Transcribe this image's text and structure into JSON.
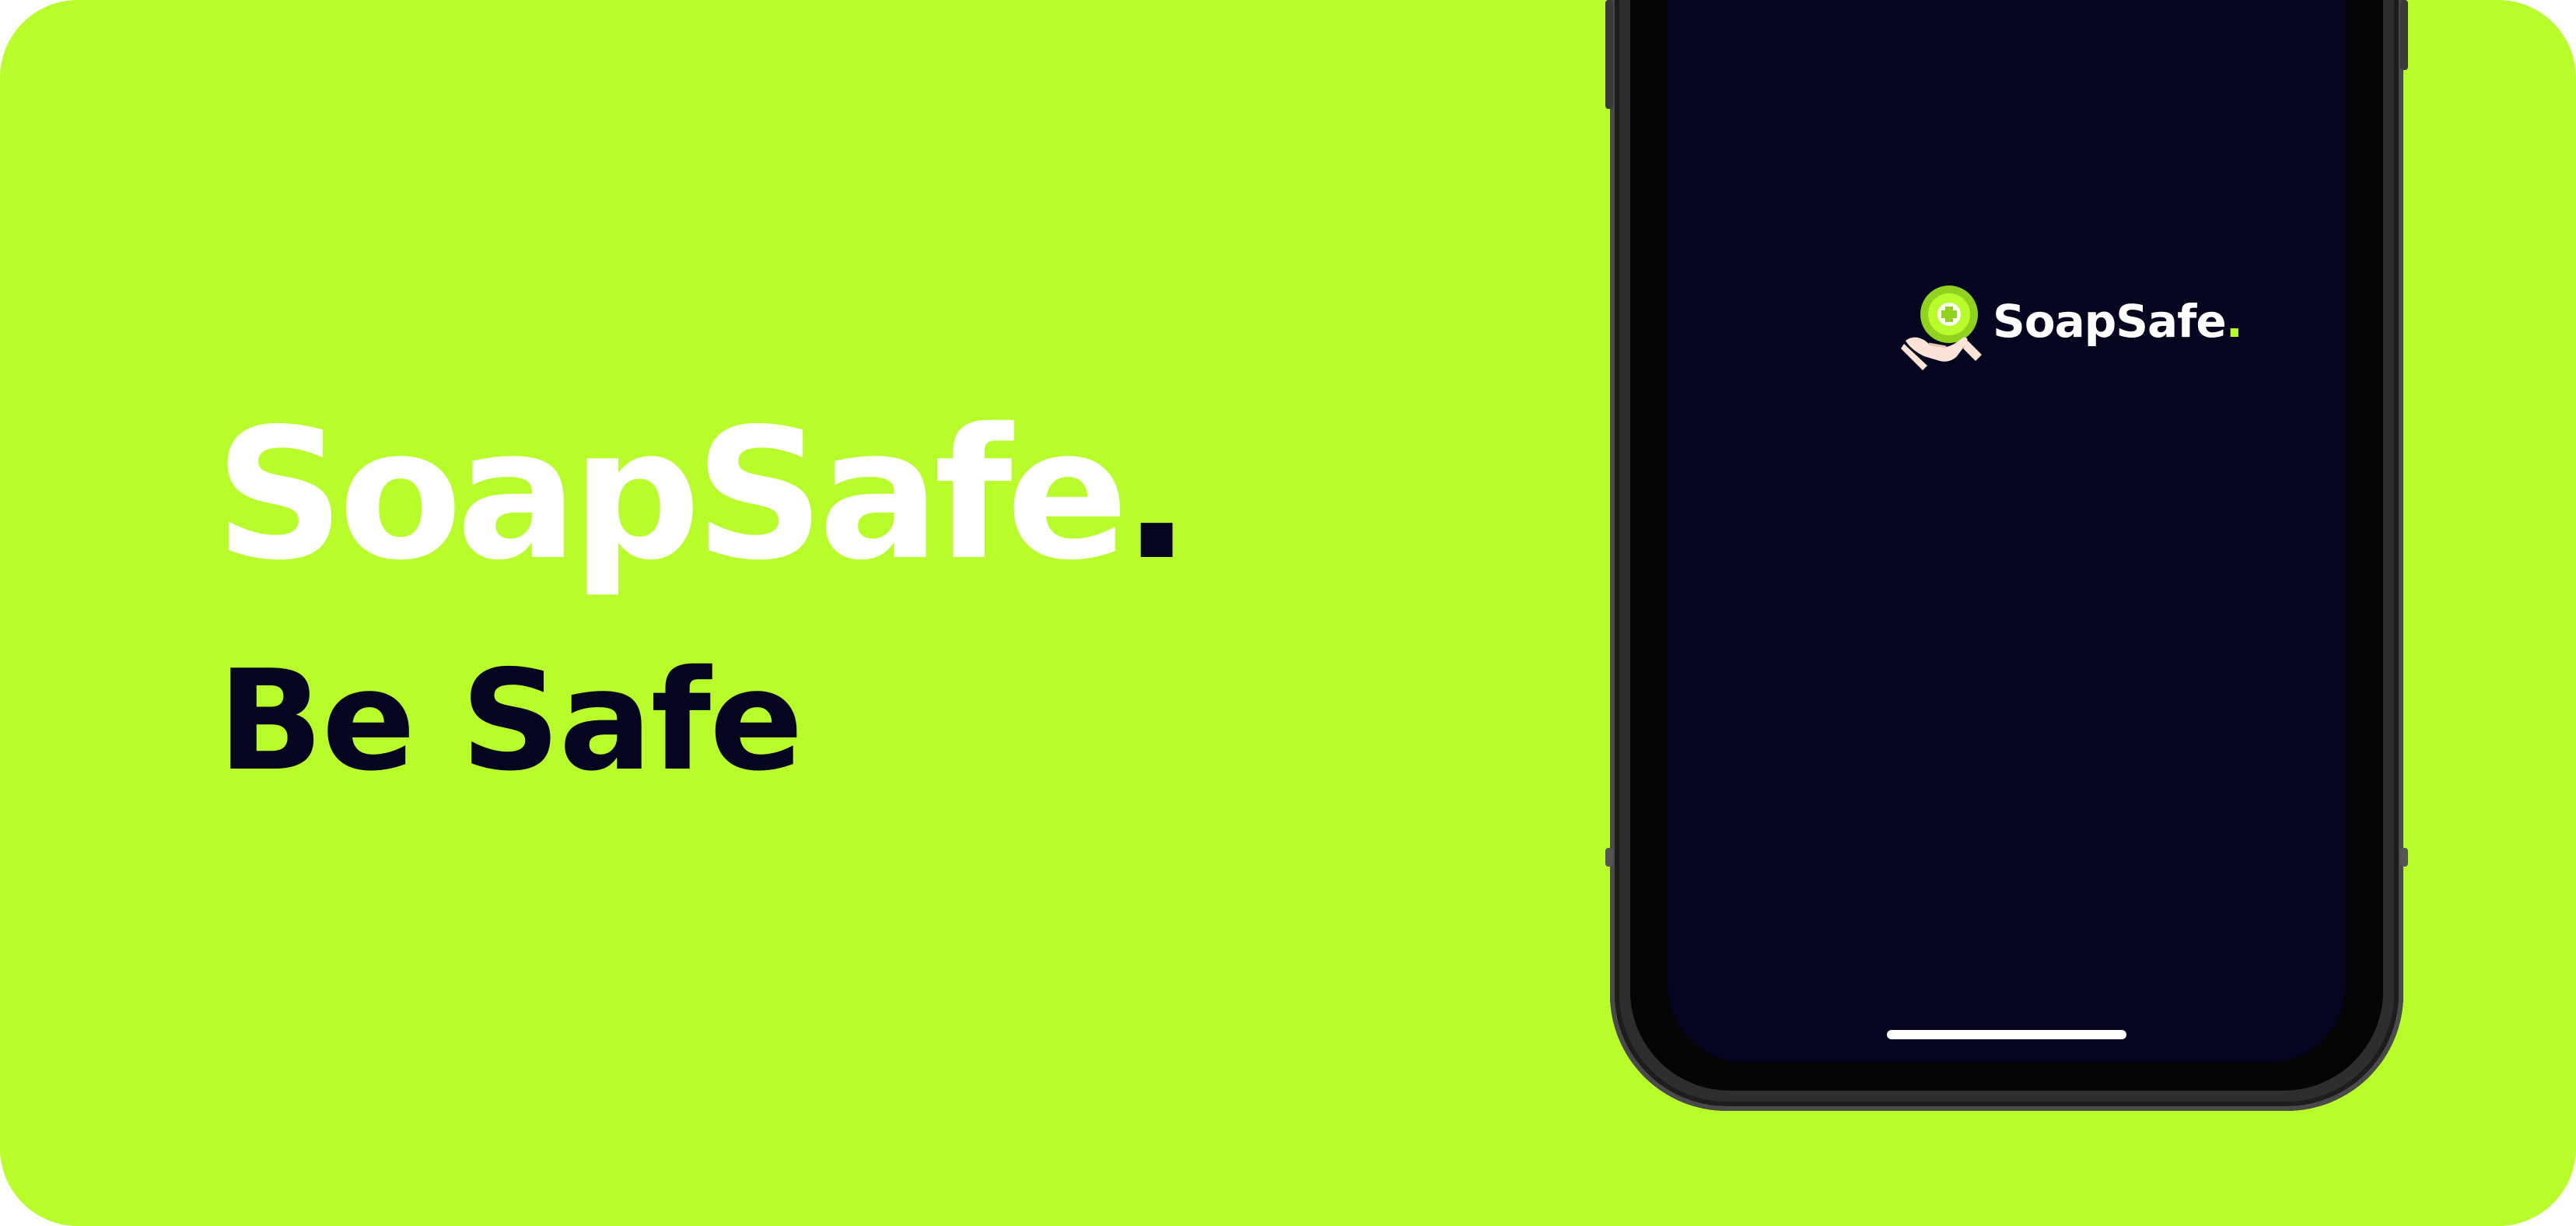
{
  "hero": {
    "title": "SoapSafe",
    "title_dot": ".",
    "tagline": "Be Safe"
  },
  "phone_screen": {
    "brand_name": "SoapSafe",
    "brand_dot": ".",
    "logo_icon": "soap-hand-plus-icon"
  },
  "colors": {
    "banner_background": "#b8fc2b",
    "screen_background": "#06051f",
    "heading_white": "#ffffff",
    "tagline_navy": "#06051f",
    "accent_green": "#b8fc2b"
  }
}
